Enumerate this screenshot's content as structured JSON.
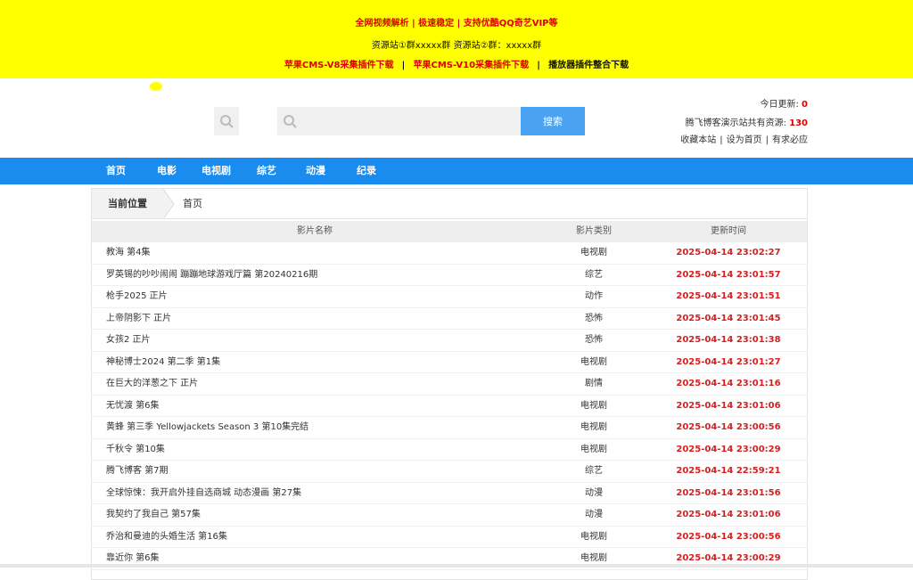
{
  "banner": {
    "line1": "全网视频解析 | 极速稳定 | 支持优酷QQ奇艺VIP等",
    "line2": "资源站①群xxxxx群 资源站②群：xxxxx群",
    "links": [
      "苹果CMS-V8采集插件下载",
      "苹果CMS-V10采集插件下载",
      "播放器插件整合下载"
    ],
    "separator": "|"
  },
  "search": {
    "placeholder": "",
    "button_label": "搜索"
  },
  "stats": {
    "today_label": "今日更新:",
    "today_count": "0",
    "total_label": "腾飞博客演示站共有资源:",
    "total_count": "130",
    "links": [
      "收藏本站",
      "设为首页",
      "有求必应"
    ],
    "separator": "|"
  },
  "nav": {
    "items": [
      "首页",
      "电影",
      "电视剧",
      "综艺",
      "动漫",
      "纪录"
    ]
  },
  "breadcrumb": {
    "label": "当前位置",
    "current": "首页"
  },
  "table": {
    "headers": [
      "影片名称",
      "影片类别",
      "更新时间"
    ],
    "rows": [
      {
        "title": "教海 第4集",
        "type": "电视剧",
        "time": "2025-04-14 23:02:27"
      },
      {
        "title": "罗英锡的吵吵闹闹 蹦蹦地球游戏厅篇 第20240216期",
        "type": "综艺",
        "time": "2025-04-14 23:01:57"
      },
      {
        "title": "枪手2025 正片",
        "type": "动作",
        "time": "2025-04-14 23:01:51"
      },
      {
        "title": "上帝阴影下 正片",
        "type": "恐怖",
        "time": "2025-04-14 23:01:45"
      },
      {
        "title": "女孩2 正片",
        "type": "恐怖",
        "time": "2025-04-14 23:01:38"
      },
      {
        "title": "神秘博士2024 第二季 第1集",
        "type": "电视剧",
        "time": "2025-04-14 23:01:27"
      },
      {
        "title": "在巨大的洋葱之下 正片",
        "type": "剧情",
        "time": "2025-04-14 23:01:16"
      },
      {
        "title": "无忧渡 第6集",
        "type": "电视剧",
        "time": "2025-04-14 23:01:06"
      },
      {
        "title": "黄蜂 第三季 Yellowjackets Season 3 第10集完结",
        "type": "电视剧",
        "time": "2025-04-14 23:00:56"
      },
      {
        "title": "千秋令 第10集",
        "type": "电视剧",
        "time": "2025-04-14 23:00:29"
      },
      {
        "title": "腾飞博客 第7期",
        "type": "综艺",
        "time": "2025-04-14 22:59:21"
      },
      {
        "title": "全球惊悚：我开启外挂自选商城 动态漫画 第27集",
        "type": "动漫",
        "time": "2025-04-14 23:01:56"
      },
      {
        "title": "我契约了我自己 第57集",
        "type": "动漫",
        "time": "2025-04-14 23:01:06"
      },
      {
        "title": "乔治和曼迪的头婚生活 第16集",
        "type": "电视剧",
        "time": "2025-04-14 23:00:56"
      },
      {
        "title": "靠近你 第6集",
        "type": "电视剧",
        "time": "2025-04-14 23:00:29"
      }
    ]
  }
}
